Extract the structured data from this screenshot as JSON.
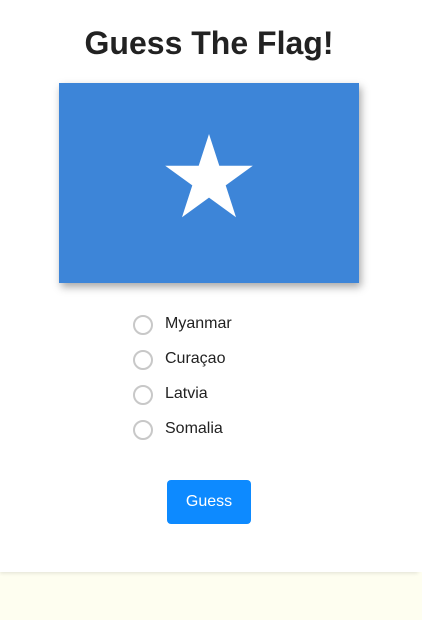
{
  "page": {
    "title": "Guess The Flag!"
  },
  "flag": {
    "icon": "somalia-flag-icon",
    "background_color": "#3d85d8",
    "star_color": "#ffffff"
  },
  "options": [
    {
      "label": "Myanmar",
      "selected": false
    },
    {
      "label": "Curaçao",
      "selected": false
    },
    {
      "label": "Latvia",
      "selected": false
    },
    {
      "label": "Somalia",
      "selected": false
    }
  ],
  "guess_button": {
    "label": "Guess",
    "color": "#0d8aff"
  },
  "colors": {
    "page_background": "#fefef0",
    "card_background": "#ffffff",
    "radio_border": "#c8c8c8"
  }
}
